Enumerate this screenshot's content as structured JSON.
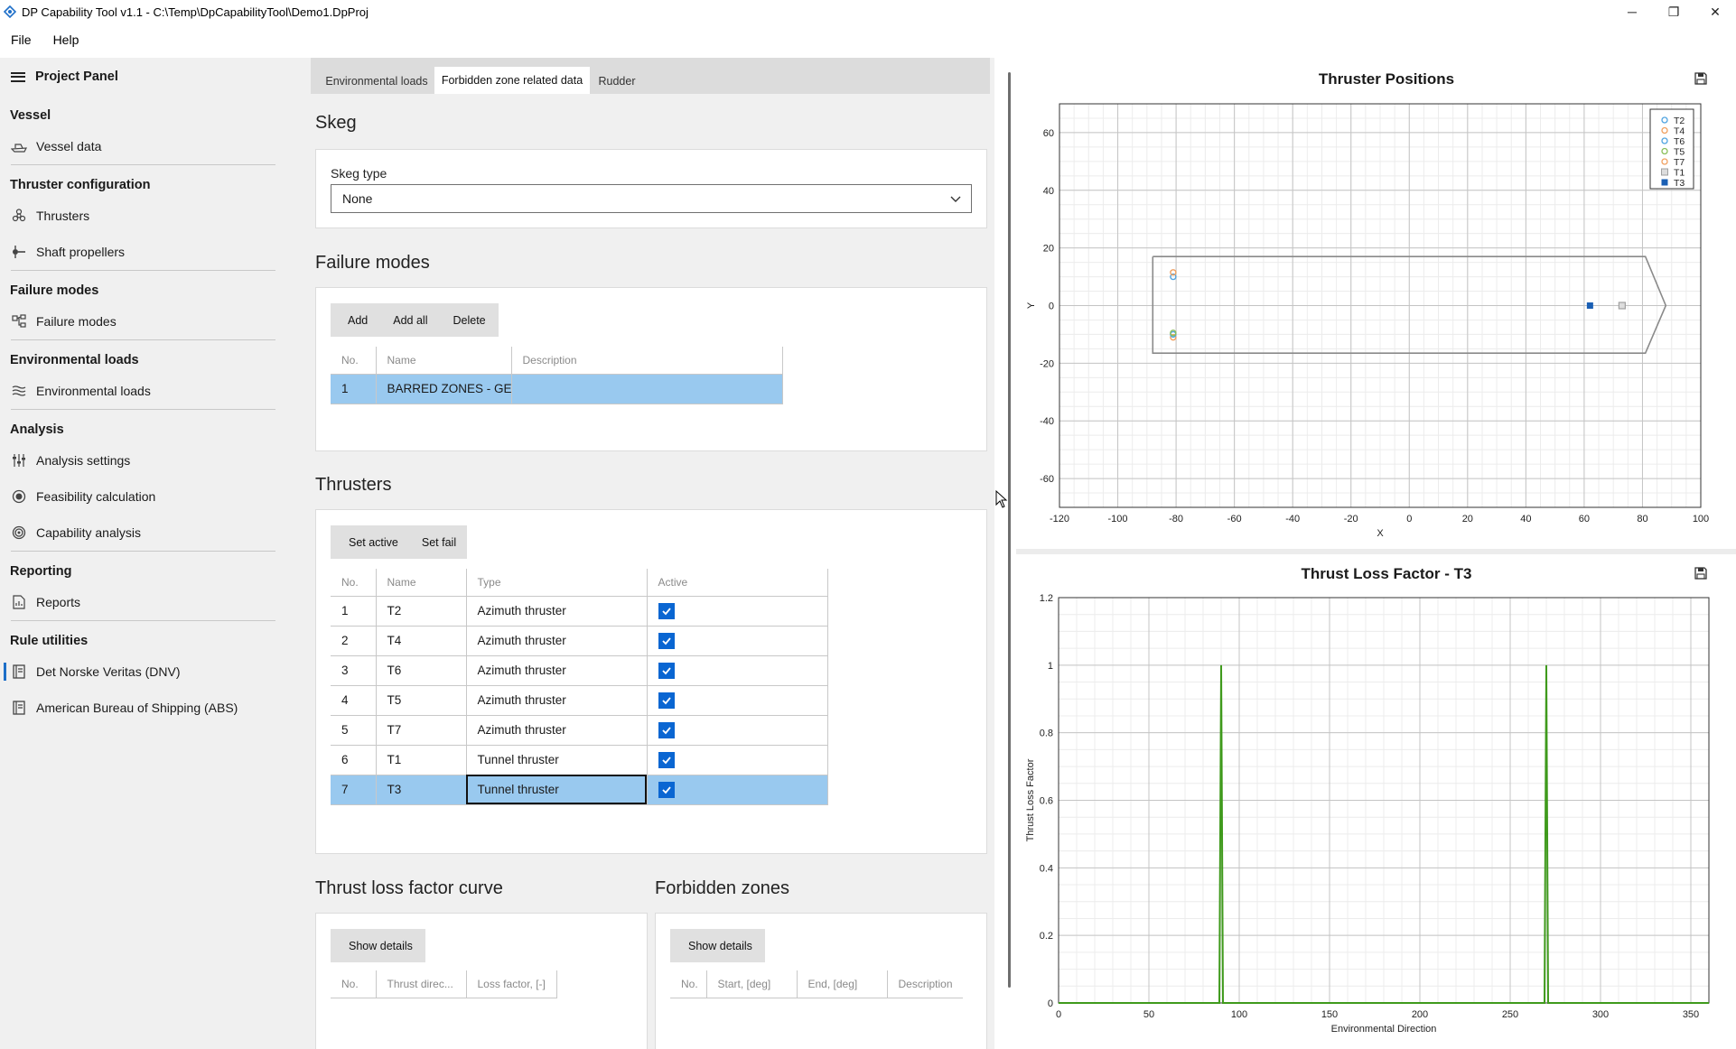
{
  "window": {
    "title": "DP Capability Tool v1.1 - C:\\Temp\\DpCapabilityTool\\Demo1.DpProj",
    "minimize": "─",
    "restore": "❐",
    "close": "✕"
  },
  "menu": [
    "File",
    "Help"
  ],
  "sidebar": {
    "header": "Project Panel",
    "sections": [
      {
        "title": "Vessel",
        "items": [
          {
            "label": "Vessel data",
            "icon": "ship-icon"
          }
        ]
      },
      {
        "title": "Thruster configuration",
        "items": [
          {
            "label": "Thrusters",
            "icon": "propeller-icon"
          },
          {
            "label": "Shaft propellers",
            "icon": "shaft-icon"
          }
        ]
      },
      {
        "title": "Failure modes",
        "items": [
          {
            "label": "Failure modes",
            "icon": "hierarchy-icon"
          }
        ]
      },
      {
        "title": "Environmental loads",
        "items": [
          {
            "label": "Environmental loads",
            "icon": "waves-icon"
          }
        ]
      },
      {
        "title": "Analysis",
        "items": [
          {
            "label": "Analysis settings",
            "icon": "sliders-icon"
          },
          {
            "label": "Feasibility calculation",
            "icon": "target-icon"
          },
          {
            "label": "Capability analysis",
            "icon": "radar-icon"
          }
        ]
      },
      {
        "title": "Reporting",
        "items": [
          {
            "label": "Reports",
            "icon": "report-icon"
          }
        ]
      },
      {
        "title": "Rule utilities",
        "items": [
          {
            "label": "Det Norske Veritas (DNV)",
            "icon": "book-icon"
          },
          {
            "label": "American Bureau of Shipping (ABS)",
            "icon": "book-icon"
          }
        ]
      }
    ]
  },
  "tabs": [
    "Environmental loads",
    "Forbidden zone related data",
    "Rudder"
  ],
  "skeg": {
    "title": "Skeg",
    "type_label": "Skeg type",
    "type_value": "None"
  },
  "failure_modes": {
    "title": "Failure modes",
    "buttons": [
      "Add",
      "Add all",
      "Delete"
    ],
    "columns": [
      "No.",
      "Name",
      "Description"
    ],
    "rows": [
      {
        "no": "1",
        "name": "BARRED ZONES - GEN",
        "description": ""
      }
    ]
  },
  "thrusters": {
    "title": "Thrusters",
    "buttons": [
      "Set active",
      "Set fail"
    ],
    "columns": [
      "No.",
      "Name",
      "Type",
      "Active"
    ],
    "rows": [
      {
        "no": "1",
        "name": "T2",
        "type": "Azimuth thruster"
      },
      {
        "no": "2",
        "name": "T4",
        "type": "Azimuth thruster"
      },
      {
        "no": "3",
        "name": "T6",
        "type": "Azimuth thruster"
      },
      {
        "no": "4",
        "name": "T5",
        "type": "Azimuth thruster"
      },
      {
        "no": "5",
        "name": "T7",
        "type": "Azimuth thruster"
      },
      {
        "no": "6",
        "name": "T1",
        "type": "Tunnel thruster"
      },
      {
        "no": "7",
        "name": "T3",
        "type": "Tunnel thruster"
      }
    ],
    "check_mark": "✓"
  },
  "thrust_loss": {
    "title": "Thrust loss factor curve",
    "button": "Show details",
    "columns": [
      "No.",
      "Thrust direc...",
      "Loss factor, [-]"
    ]
  },
  "forbidden_zones": {
    "title": "Forbidden zones",
    "button": "Show details",
    "columns": [
      "No.",
      "Start, [deg]",
      "End, [deg]",
      "Description"
    ]
  },
  "chart_data": [
    {
      "type": "scatter",
      "title": "Thruster Positions",
      "xlabel": "X",
      "ylabel": "Y",
      "xlim": [
        -120,
        100
      ],
      "ylim": [
        -70,
        70
      ],
      "xticks": [
        -120,
        -100,
        -80,
        -60,
        -40,
        -20,
        0,
        20,
        40,
        60,
        80,
        100
      ],
      "yticks": [
        -60,
        -40,
        -20,
        0,
        20,
        40,
        60
      ],
      "grid": true,
      "legend": "top-right",
      "hull_outline": {
        "x": [
          -88,
          81,
          88,
          81,
          -88,
          -88
        ],
        "y": [
          17,
          17,
          0,
          -16.5,
          -16.5,
          17
        ]
      },
      "series": [
        {
          "name": "T2",
          "color": "#4fa3e0",
          "marker": "circle-open",
          "x": [
            -81
          ],
          "y": [
            10
          ]
        },
        {
          "name": "T4",
          "color": "#f0a060",
          "marker": "circle-open",
          "x": [
            -81
          ],
          "y": [
            -11
          ]
        },
        {
          "name": "T6",
          "color": "#4fa3e0",
          "marker": "circle-open",
          "x": [
            -81
          ],
          "y": [
            -10
          ]
        },
        {
          "name": "T5",
          "color": "#8abf5a",
          "marker": "circle-open",
          "x": [
            -81
          ],
          "y": [
            -9.5
          ]
        },
        {
          "name": "T7",
          "color": "#f0a060",
          "marker": "circle-open",
          "x": [
            -81
          ],
          "y": [
            11.5
          ]
        },
        {
          "name": "T1",
          "color": "#a0a0a0",
          "marker": "square-open",
          "x": [
            73
          ],
          "y": [
            0
          ]
        },
        {
          "name": "T3",
          "color": "#1a5fb4",
          "marker": "square",
          "x": [
            62
          ],
          "y": [
            0
          ]
        }
      ]
    },
    {
      "type": "line",
      "title": "Thrust Loss Factor - T3",
      "xlabel": "Environmental Direction",
      "ylabel": "Thrust Loss Factor",
      "xlim": [
        0,
        360
      ],
      "ylim": [
        0,
        1.2
      ],
      "xticks": [
        0,
        50,
        100,
        150,
        200,
        250,
        300,
        350
      ],
      "yticks": [
        0,
        0.2,
        0.4,
        0.6,
        0.8,
        1,
        1.2
      ],
      "grid": true,
      "color": "#3f9a1c",
      "x": [
        0,
        88,
        89,
        90,
        91,
        92,
        268,
        269,
        270,
        271,
        272,
        360
      ],
      "y": [
        0,
        0,
        0,
        1,
        0,
        0,
        0,
        0,
        1,
        0,
        0,
        0
      ]
    }
  ]
}
